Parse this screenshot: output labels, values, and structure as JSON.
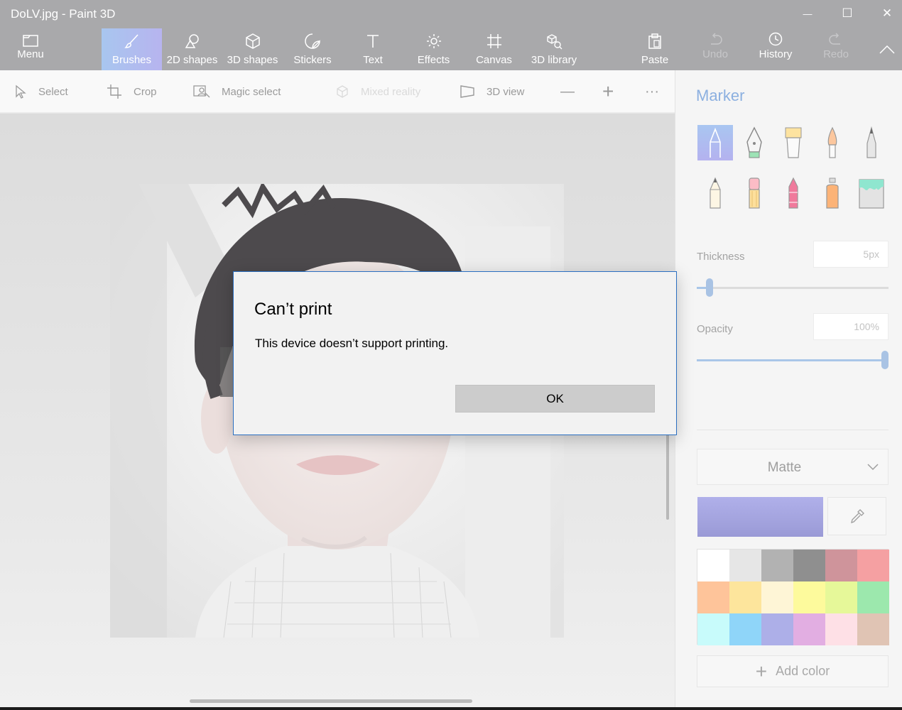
{
  "window": {
    "title": "DoLV.jpg - Paint 3D",
    "controls": {
      "minimize": "—",
      "maximize": "☐",
      "close": "✕"
    }
  },
  "ribbon": {
    "menu_label": "Menu",
    "items": [
      {
        "label": "Brushes",
        "icon": "brush-icon",
        "active": true
      },
      {
        "label": "2D shapes",
        "icon": "2d-shapes-icon"
      },
      {
        "label": "3D shapes",
        "icon": "3d-shapes-icon"
      },
      {
        "label": "Stickers",
        "icon": "stickers-icon"
      },
      {
        "label": "Text",
        "icon": "text-icon"
      },
      {
        "label": "Effects",
        "icon": "effects-icon"
      },
      {
        "label": "Canvas",
        "icon": "canvas-icon"
      },
      {
        "label": "3D library",
        "icon": "3d-library-icon"
      }
    ],
    "right_items": [
      {
        "label": "Paste",
        "icon": "paste-icon"
      },
      {
        "label": "Undo",
        "icon": "undo-icon",
        "disabled": true
      },
      {
        "label": "History",
        "icon": "history-icon"
      },
      {
        "label": "Redo",
        "icon": "redo-icon",
        "disabled": true
      }
    ]
  },
  "toolbar": {
    "select": "Select",
    "crop": "Crop",
    "magic_select": "Magic select",
    "mixed_reality": "Mixed reality",
    "view_3d": "3D view",
    "zoom_out": "—",
    "zoom_in": "+",
    "more": "···"
  },
  "panel": {
    "title": "Marker",
    "brushes": [
      "marker-icon",
      "calligraphy-pen-icon",
      "oil-brush-icon",
      "watercolor-icon",
      "pixel-pen-icon",
      "pencil-icon",
      "eraser-icon",
      "crayon-icon",
      "spray-can-icon",
      "fill-bucket-icon"
    ],
    "thickness_label": "Thickness",
    "thickness_value": "5px",
    "thickness_fraction": 0.05,
    "opacity_label": "Opacity",
    "opacity_value": "100%",
    "opacity_fraction": 1.0,
    "finish": "Matte",
    "current_color": "#b0b0ea",
    "palette": [
      "#ffffff",
      "#e6e6e6",
      "#b2b2b2",
      "#8f8f8f",
      "#cf949b",
      "#f5a0a2",
      "#fec49a",
      "#fde59c",
      "#fef5d6",
      "#fdfa9c",
      "#e6f899",
      "#9ce8ad",
      "#c8fbfb",
      "#8fd5f9",
      "#adafe8",
      "#e2aee2",
      "#fee0e6",
      "#e0c4b4"
    ],
    "add_color": "Add color"
  },
  "dialog": {
    "title": "Can’t print",
    "message": "This device doesn’t support printing.",
    "ok": "OK"
  }
}
